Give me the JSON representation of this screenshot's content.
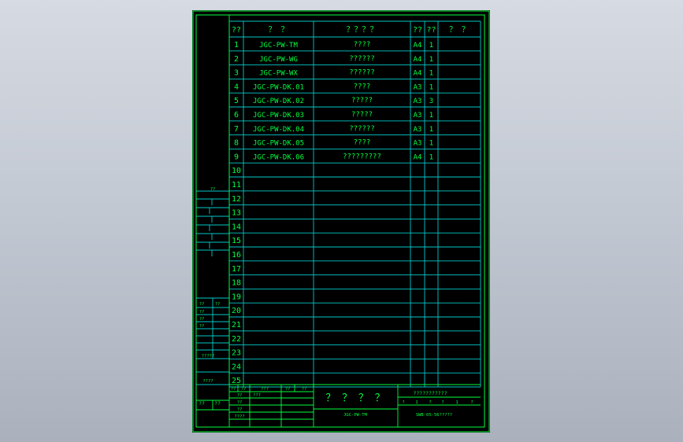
{
  "header": {
    "col_index": "??",
    "col_code": "？ ？",
    "col_name": "？？？？",
    "col_size": "??",
    "col_qty": "??",
    "col_note": "？ ？"
  },
  "rows": [
    {
      "n": "1",
      "code": "JGC-PW-TM",
      "name": "????",
      "size": "A4",
      "qty": "1"
    },
    {
      "n": "2",
      "code": "JGC-PW-WG",
      "name": "??????",
      "size": "A4",
      "qty": "1"
    },
    {
      "n": "3",
      "code": "JGC-PW-WX",
      "name": "??????",
      "size": "A4",
      "qty": "1"
    },
    {
      "n": "4",
      "code": "JGC-PW-DK.01",
      "name": "????",
      "size": "A3",
      "qty": "1"
    },
    {
      "n": "5",
      "code": "JGC-PW-DK.02",
      "name": "?????",
      "size": "A3",
      "qty": "3"
    },
    {
      "n": "6",
      "code": "JGC-PW-DK.03",
      "name": "?????",
      "size": "A3",
      "qty": "1"
    },
    {
      "n": "7",
      "code": "JGC-PW-DK.04",
      "name": "??????",
      "size": "A3",
      "qty": "1"
    },
    {
      "n": "8",
      "code": "JGC-PW-DK.05",
      "name": "????",
      "size": "A3",
      "qty": "1"
    },
    {
      "n": "9",
      "code": "JGC-PW-DK.06",
      "name": "?????????",
      "size": "A4",
      "qty": "1"
    },
    {
      "n": "10",
      "code": "",
      "name": "",
      "size": "",
      "qty": ""
    },
    {
      "n": "11",
      "code": "",
      "name": "",
      "size": "",
      "qty": ""
    },
    {
      "n": "12",
      "code": "",
      "name": "",
      "size": "",
      "qty": ""
    },
    {
      "n": "13",
      "code": "",
      "name": "",
      "size": "",
      "qty": ""
    },
    {
      "n": "14",
      "code": "",
      "name": "",
      "size": "",
      "qty": ""
    },
    {
      "n": "15",
      "code": "",
      "name": "",
      "size": "",
      "qty": ""
    },
    {
      "n": "16",
      "code": "",
      "name": "",
      "size": "",
      "qty": ""
    },
    {
      "n": "17",
      "code": "",
      "name": "",
      "size": "",
      "qty": ""
    },
    {
      "n": "18",
      "code": "",
      "name": "",
      "size": "",
      "qty": ""
    },
    {
      "n": "19",
      "code": "",
      "name": "",
      "size": "",
      "qty": ""
    },
    {
      "n": "20",
      "code": "",
      "name": "",
      "size": "",
      "qty": ""
    },
    {
      "n": "21",
      "code": "",
      "name": "",
      "size": "",
      "qty": ""
    },
    {
      "n": "22",
      "code": "",
      "name": "",
      "size": "",
      "qty": ""
    },
    {
      "n": "23",
      "code": "",
      "name": "",
      "size": "",
      "qty": ""
    },
    {
      "n": "24",
      "code": "",
      "name": "",
      "size": "",
      "qty": ""
    },
    {
      "n": "25",
      "code": "",
      "name": "",
      "size": "",
      "qty": ""
    }
  ],
  "left_strip": {
    "top_label": "??",
    "pair_labels": [
      "??",
      "??"
    ],
    "side_labels": [
      "??",
      "??",
      "??"
    ],
    "label_5q": "?????",
    "label_4q": "????",
    "bottom_pair": [
      "??",
      "??"
    ]
  },
  "title_block": {
    "sig_row1": [
      "??",
      "??",
      "???",
      "??",
      "??"
    ],
    "sig_left_col": [
      "??",
      "??",
      "??",
      "????"
    ],
    "sig_row2_extra": "???",
    "drawing_title": "？ ？ ？ ？",
    "drawing_code": "JGC-PW-TM",
    "company": "???????????",
    "scale_row": [
      "?",
      "1",
      "?",
      "?",
      "1",
      "?"
    ],
    "doc_number": "SWB-05-56?????"
  },
  "colors": {
    "background": "#000000",
    "frame_green": "#00ff40",
    "table_cyan": "#00c8c8",
    "desktop": "#c3c9d3"
  }
}
